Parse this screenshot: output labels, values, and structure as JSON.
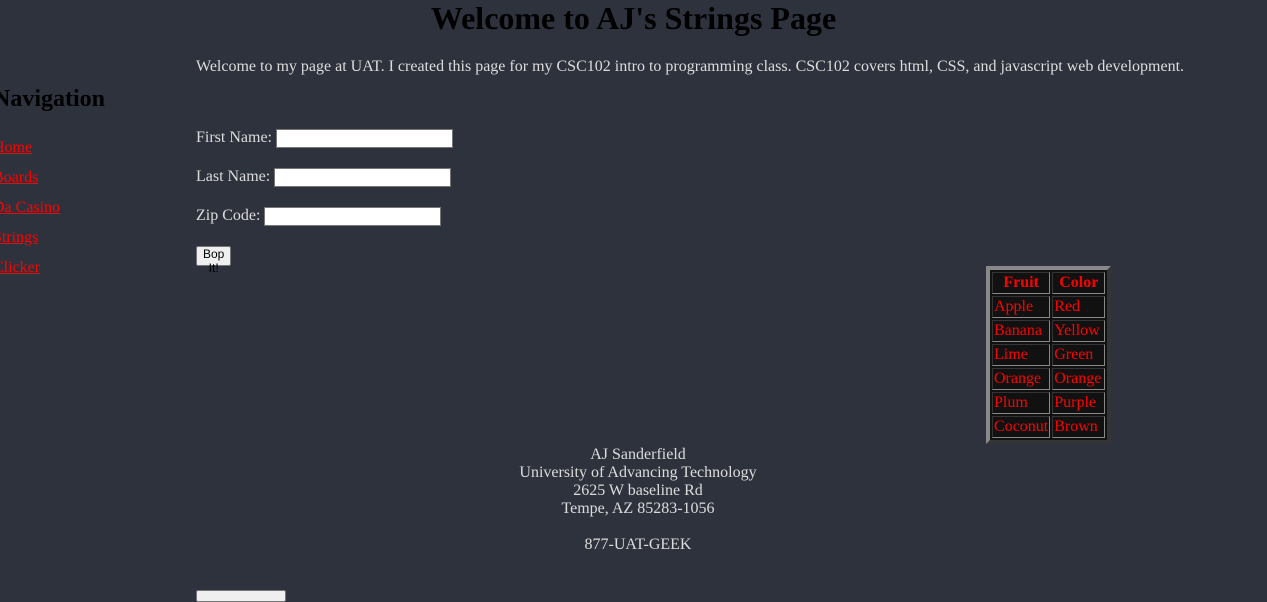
{
  "header": {
    "title": "Welcome to AJ's Strings Page"
  },
  "intro": {
    "text": "Welcome to my page at UAT. I created this page for my CSC102 intro to programming class. CSC102 covers html, CSS, and javascript web development."
  },
  "nav": {
    "heading": "Navigation",
    "items": [
      {
        "label": "Home"
      },
      {
        "label": "Boards"
      },
      {
        "label": "Da Casino"
      },
      {
        "label": "Strings"
      },
      {
        "label": "Clicker"
      }
    ]
  },
  "form": {
    "first_name_label": "First Name:",
    "first_name_value": "",
    "last_name_label": "Last Name:",
    "last_name_value": "",
    "zip_label": "Zip Code:",
    "zip_value": "",
    "submit_label": "Bop It!"
  },
  "table": {
    "headers": [
      "Fruit",
      "Color"
    ],
    "rows": [
      [
        "Apple",
        "Red"
      ],
      [
        "Banana",
        "Yellow"
      ],
      [
        "Lime",
        "Green"
      ],
      [
        "Orange",
        "Orange"
      ],
      [
        "Plum",
        "Purple"
      ],
      [
        "Coconut",
        "Brown"
      ]
    ]
  },
  "footer": {
    "name": "AJ Sanderfield",
    "school": "University of Advancing Technology",
    "street": "2625 W baseline Rd",
    "city": "Tempe, AZ 85283-1056",
    "phone": "877-UAT-GEEK"
  },
  "colors": {
    "background": "#2e323d",
    "link": "#ff0000",
    "heading": "#000000",
    "text": "#dcdcdc"
  }
}
